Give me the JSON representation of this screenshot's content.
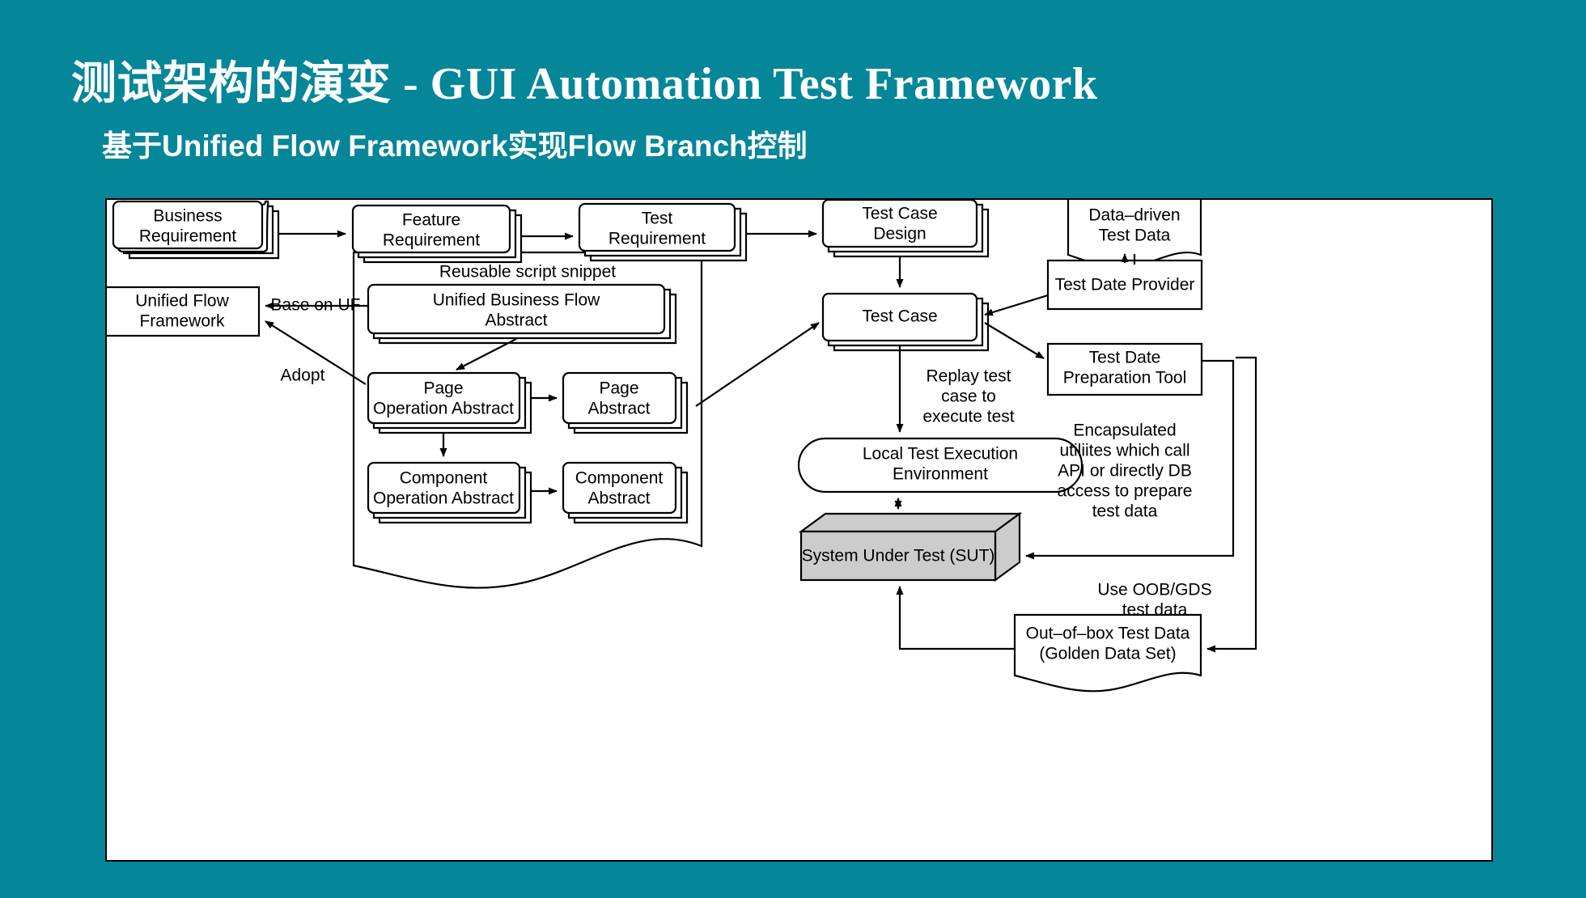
{
  "slide": {
    "background_color": "#068699",
    "title": "测试架构的演变 -  GUI Automation Test Framework",
    "subtitle": "基于Unified Flow Framework实现Flow Branch控制"
  },
  "diagram": {
    "canvas_background": "#ffffff",
    "sut_fill": "#cccccc",
    "nodes": {
      "business_requirement": "Business\nRequirement",
      "business_requirement_l1": "Business",
      "business_requirement_l2": "Requirement",
      "feature_requirement_l1": "Feature",
      "feature_requirement_l2": "Requirement",
      "test_requirement_l1": "Test",
      "test_requirement_l2": "Requirement",
      "test_case_design_l1": "Test Case",
      "test_case_design_l2": "Design",
      "data_driven_test_data_l1": "Data–driven",
      "data_driven_test_data_l2": "Test Data",
      "test_date_provider": "Test Date Provider",
      "test_date_preparation_tool_l1": "Test Date",
      "test_date_preparation_tool_l2": "Preparation Tool",
      "test_case": "Test Case",
      "unified_flow_framework_l1": "Unified Flow",
      "unified_flow_framework_l2": "Framework",
      "reusable_script_snippet": "Reusable script snippet",
      "unified_business_flow_abstract_l1": "Unified Business Flow",
      "unified_business_flow_abstract_l2": "Abstract",
      "page_operation_abstract_l1": "Page",
      "page_operation_abstract_l2": "Operation Abstract",
      "page_abstract_l1": "Page",
      "page_abstract_l2": "Abstract",
      "component_operation_abstract_l1": "Component",
      "component_operation_abstract_l2": "Operation Abstract",
      "component_abstract_l1": "Component",
      "component_abstract_l2": "Abstract",
      "local_test_execution_environment_l1": "Local Test Execution",
      "local_test_execution_environment_l2": "Environment",
      "system_under_test": "System Under Test (SUT)",
      "out_of_box_test_data_l1": "Out–of–box Test Data",
      "out_of_box_test_data_l2": "(Golden Data Set)"
    },
    "edge_labels": {
      "base_on_uf": "Base on UF",
      "adopt": "Adopt",
      "replay_l1": "Replay test",
      "replay_l2": "case to",
      "replay_l3": "execute test",
      "encapsulated_l1": "Encapsulated",
      "encapsulated_l2": "utiliites which call",
      "encapsulated_l3": "API or directly DB",
      "encapsulated_l4": "access to prepare",
      "encapsulated_l5": "test data",
      "use_oob_l1": "Use OOB/GDS",
      "use_oob_l2": "test data"
    }
  }
}
